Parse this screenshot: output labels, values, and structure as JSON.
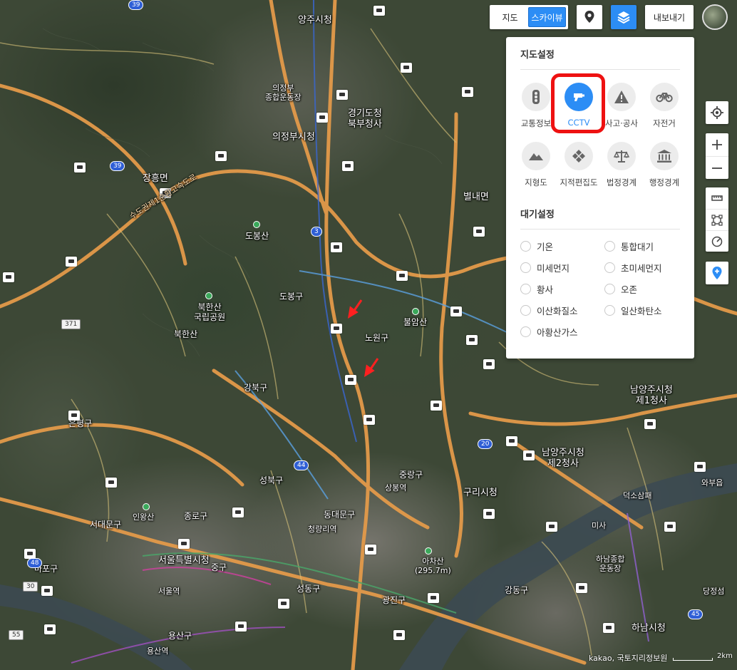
{
  "map_type": {
    "map_label": "지도",
    "skyview_label": "스카이뷰",
    "active": "skyview"
  },
  "toolbar": {
    "export_label": "내보내기"
  },
  "layer_panel": {
    "map_settings_title": "지도설정",
    "map_layers": [
      {
        "label": "교통정보",
        "icon": "traffic-light-icon",
        "selected": false
      },
      {
        "label": "CCTV",
        "icon": "cctv-icon",
        "selected": true
      },
      {
        "label": "사고·공사",
        "icon": "warning-icon",
        "selected": false
      },
      {
        "label": "자전거",
        "icon": "bicycle-icon",
        "selected": false
      },
      {
        "label": "지형도",
        "icon": "mountain-icon",
        "selected": false
      },
      {
        "label": "지적편집도",
        "icon": "cadastral-icon",
        "selected": false
      },
      {
        "label": "법정경계",
        "icon": "scales-icon",
        "selected": false
      },
      {
        "label": "행정경계",
        "icon": "government-building-icon",
        "selected": false
      }
    ],
    "air_settings_title": "대기설정",
    "air_options": [
      {
        "label": "기온",
        "selected": false
      },
      {
        "label": "통합대기",
        "selected": false
      },
      {
        "label": "미세먼지",
        "selected": false
      },
      {
        "label": "초미세먼지",
        "selected": false
      },
      {
        "label": "황사",
        "selected": false
      },
      {
        "label": "오존",
        "selected": false
      },
      {
        "label": "이산화질소",
        "selected": false
      },
      {
        "label": "일산화탄소",
        "selected": false
      },
      {
        "label": "아황산가스",
        "selected": false
      }
    ]
  },
  "map": {
    "places": {
      "yangju": "양주시청",
      "uijeongbu_stadium": "의정부\n종합운동장",
      "gyeonggi_north": "경기도청\n북부청사",
      "uijeongbu": "의정부시청",
      "jangheung": "장흥면",
      "dobongsan": "도봉산",
      "bukhansan_park": "북한산\n국립공원",
      "bukhansan": "북한산",
      "buramsan": "불암산",
      "byeollae": "별내면",
      "namyangju1": "남양주시청\n제1청사",
      "namyangju2": "남양주시청\n제2청사",
      "guri": "구리시청",
      "seoul": "서울특별시청",
      "inwangsan": "인왕산",
      "seoul_station": "서울역",
      "cheongnyangni": "청량리역",
      "sangbong": "상봉역",
      "achasan": "아차산\n(295.7m)",
      "hanam_stadium": "하남종합\n운동장",
      "hanam": "하남시청",
      "yongsan": "용산역",
      "seongbuk": "성북구",
      "mapo": "마포구",
      "gangbuk": "강북구",
      "dobong": "도봉구",
      "nowon": "노원구",
      "jungnang": "중랑구",
      "jongno": "종로구",
      "jung": "중구",
      "seongdong": "성동구",
      "gwangjin": "광진구",
      "gangdong": "강동구",
      "yongsan_gu": "용산구",
      "dongdaemun": "동대문구",
      "seodaemun": "서대문구",
      "eunpyeong": "은평구",
      "deokso": "덕소삼패",
      "waebu": "와부읍",
      "misa": "미사",
      "dangjeong": "당정섬"
    },
    "road_shields": [
      "39",
      "39",
      "3",
      "371",
      "44",
      "20",
      "48",
      "30",
      "55",
      "45"
    ],
    "highway_label": "수도권제1순환고속도로"
  },
  "footer": {
    "copyright": "kakao, 국토지리정보원",
    "scale": "2km"
  }
}
